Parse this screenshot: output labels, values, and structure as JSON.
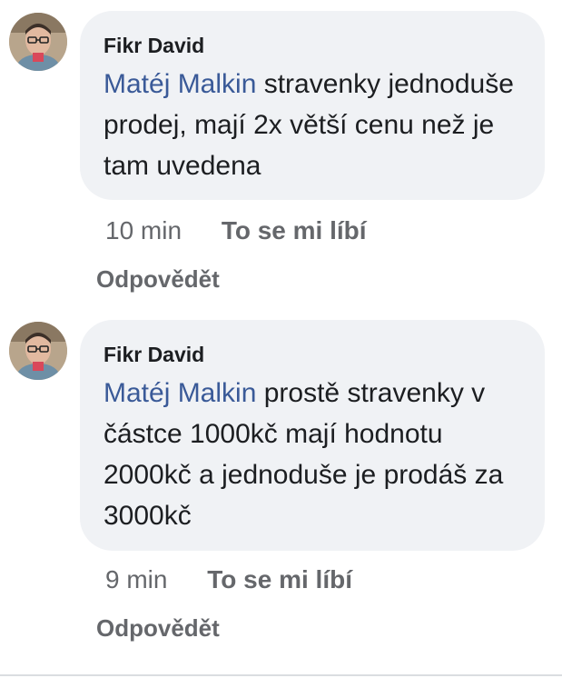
{
  "comments": [
    {
      "author": "Fikr David",
      "mention": "Matéj Malkin",
      "text": " stravenky jednoduše prodej, mají 2x větší cenu než je tam uvedena",
      "time": "10 min",
      "like_label": "To se mi líbí",
      "reply_label": "Odpovědět"
    },
    {
      "author": "Fikr David",
      "mention": "Matéj Malkin",
      "text": " prostě stravenky v částce 1000kč mají hodnotu 2000kč a jednoduše je prodáš za 3000kč",
      "time": "9 min",
      "like_label": "To se mi líbí",
      "reply_label": "Odpovědět"
    }
  ],
  "colors": {
    "bubble_bg": "#f0f2f5",
    "mention": "#3a5a98",
    "meta_text": "#65676b"
  },
  "icons": {
    "avatar": "profile-photo"
  }
}
